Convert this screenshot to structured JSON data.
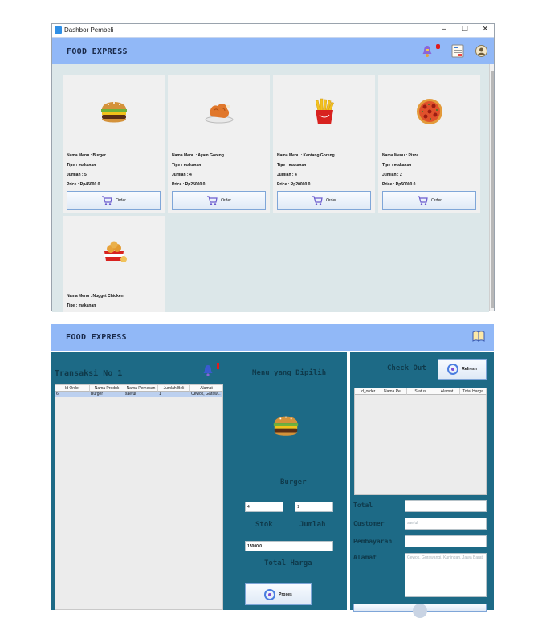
{
  "top_window": {
    "title": "Dashbor Pembeli",
    "controls": {
      "minimize": "–",
      "maximize": "☐",
      "close": "✕"
    },
    "brand": "FOOD EXPRESS",
    "header_icons": [
      "notification-bell-icon",
      "receipt-icon",
      "profile-icon"
    ],
    "notification_badge": "",
    "cards": [
      {
        "name": "Nama Menu : Burger",
        "tipe": "Tipe : makanan",
        "jumlah": "Jumlah : 5",
        "price": "Price : Rp45000.0",
        "order": "Order",
        "image": "burger-image"
      },
      {
        "name": "Nama Menu : Ayam Goreng",
        "tipe": "Tipe : makanan",
        "jumlah": "Jumlah : 4",
        "price": "Price : Rp25000.0",
        "order": "Order",
        "image": "fried-chicken-image"
      },
      {
        "name": "Nama Menu : Kentang Goreng",
        "tipe": "Tipe : makanan",
        "jumlah": "Jumlah : 4",
        "price": "Price : Rp20000.0",
        "order": "Order",
        "image": "french-fries-image"
      },
      {
        "name": "Nama Menu : Pizza",
        "tipe": "Tipe : makanan",
        "jumlah": "Jumlah : 2",
        "price": "Price : Rp50000.0",
        "order": "Order",
        "image": "pizza-image"
      },
      {
        "name": "Nama Menu : Nugget Chicken",
        "tipe": "Tipe : makanan",
        "jumlah": "",
        "price": "",
        "order": "",
        "image": "nuggets-image"
      }
    ]
  },
  "bottom_window": {
    "brand": "FOOD EXPRESS",
    "book_icon": "book-icon",
    "transaksi_title": "Transaksi No 1",
    "transaksi_table": {
      "columns": [
        "Id Order",
        "Nama Produk",
        "Nama Pemesan",
        "Jumlah Beli",
        "Alamat"
      ],
      "rows": [
        [
          "6",
          "Burger",
          "saeful",
          "1",
          "Cewok, Garaw..."
        ]
      ]
    },
    "menu_title": "Menu yang Dipilih",
    "selected_menu": "Burger",
    "stok_value": "4",
    "jumlah_value": "1",
    "stok_label": "Stok",
    "jumlah_label": "Jumlah",
    "total_value": "15000.0",
    "total_harga_label": "Total Harga",
    "proses_button": "Proses",
    "checkout_title": "Check Out",
    "refresh_button": "Refresh",
    "checkout_table": {
      "columns": [
        "Id_order",
        "Nama Pe...",
        "Status",
        "Alamat",
        "Total Harga"
      ]
    },
    "total_label": "Total",
    "customer_label": "Customer",
    "customer_value": "saeful",
    "pembayaran_label": "Pembayaran",
    "alamat_label": "Alamat",
    "alamat_value": "Cewok, Gurawangi, Kuningan, Jawa Barat."
  }
}
